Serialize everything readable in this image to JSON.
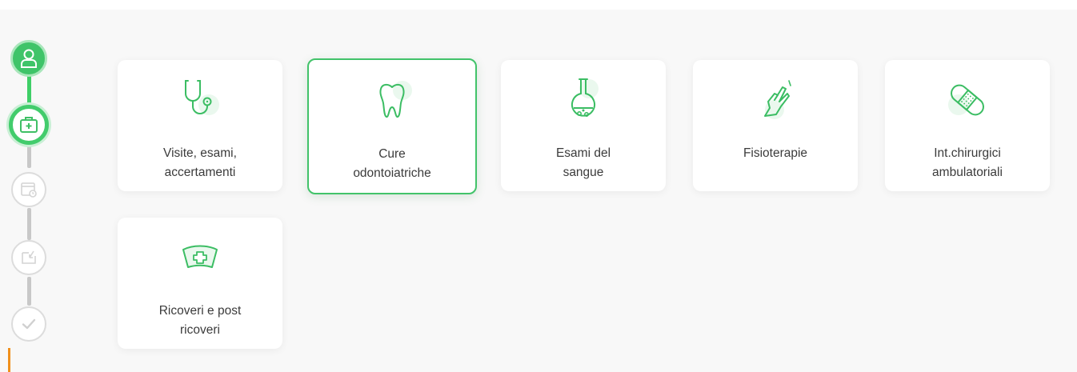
{
  "stepper": {
    "steps": [
      {
        "state": "completed",
        "icon": "user-icon"
      },
      {
        "state": "current",
        "icon": "medical-kit-icon"
      },
      {
        "state": "pending",
        "icon": "calendar-time-icon"
      },
      {
        "state": "pending",
        "icon": "inbox-download-icon"
      },
      {
        "state": "pending",
        "icon": "checkmark-icon"
      }
    ],
    "colors": {
      "active": "#3fc469",
      "inactive": "#c8c8c8",
      "accent": "#f0901c"
    }
  },
  "categories": [
    {
      "label": "Visite, esami,\naccertamenti",
      "icon": "stethoscope-icon",
      "selected": false
    },
    {
      "label": "Cure\nodontoiatriche",
      "icon": "tooth-icon",
      "selected": true
    },
    {
      "label": "Esami del\nsangue",
      "icon": "flask-icon",
      "selected": false
    },
    {
      "label": "Fisioterapie",
      "icon": "hand-icon",
      "selected": false
    },
    {
      "label": "Int.chirurgici\nambulatoriali",
      "icon": "bandage-icon",
      "selected": false
    },
    {
      "label": "Ricoveri e post\nricoveri",
      "icon": "nurse-cap-icon",
      "selected": false
    }
  ]
}
